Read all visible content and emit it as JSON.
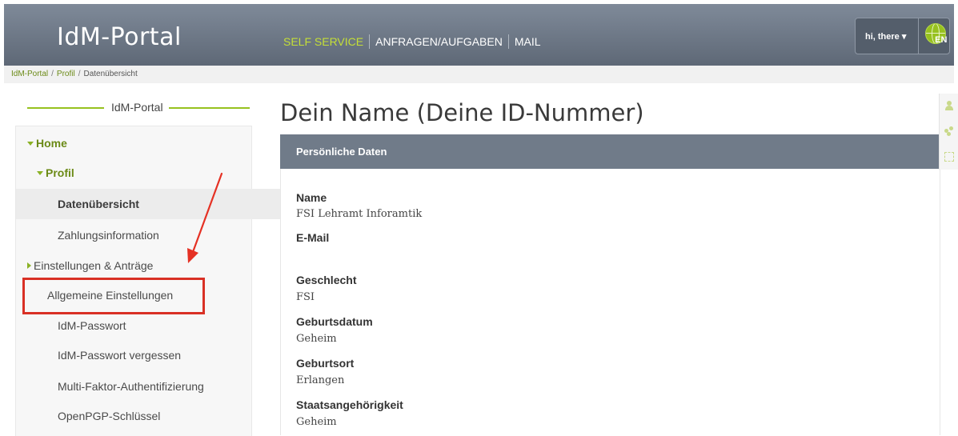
{
  "header": {
    "logo": "IdM-Portal",
    "nav": [
      "SELF SERVICE",
      "ANFRAGEN/AUFGABEN",
      "MAIL"
    ],
    "user_label": "hi, there",
    "language": "EN",
    "colors": {
      "bar": "#6b7583",
      "accent": "#c5df37"
    }
  },
  "breadcrumb": [
    "IdM-Portal",
    "Profil",
    "Datenübersicht"
  ],
  "sidebar": {
    "title": "IdM-Portal",
    "items": [
      {
        "label": "Home"
      },
      {
        "label": "Profil"
      },
      {
        "label": "Datenübersicht"
      },
      {
        "label": "Zahlungsinformation"
      },
      {
        "label": "Einstellungen & Anträge"
      },
      {
        "label": "Allgemeine Einstellungen"
      },
      {
        "label": "IdM-Passwort"
      },
      {
        "label": "IdM-Passwort vergessen"
      },
      {
        "label": "Multi-Faktor-Authentifizierung"
      },
      {
        "label": "OpenPGP-Schlüssel"
      }
    ]
  },
  "main": {
    "title": "Dein Name (Deine ID-Nummer)",
    "section_title": "Persönliche Daten",
    "fields": [
      {
        "label": "Name",
        "value": "FSI Lehramt Inforamtik"
      },
      {
        "label": "E-Mail",
        "value": ""
      },
      {
        "label": "Geschlecht",
        "value": "FSI"
      },
      {
        "label": "Geburtsdatum",
        "value": "Geheim"
      },
      {
        "label": "Geburtsort",
        "value": "Erlangen"
      },
      {
        "label": "Staatsangehörigkeit",
        "value": "Geheim"
      }
    ]
  }
}
